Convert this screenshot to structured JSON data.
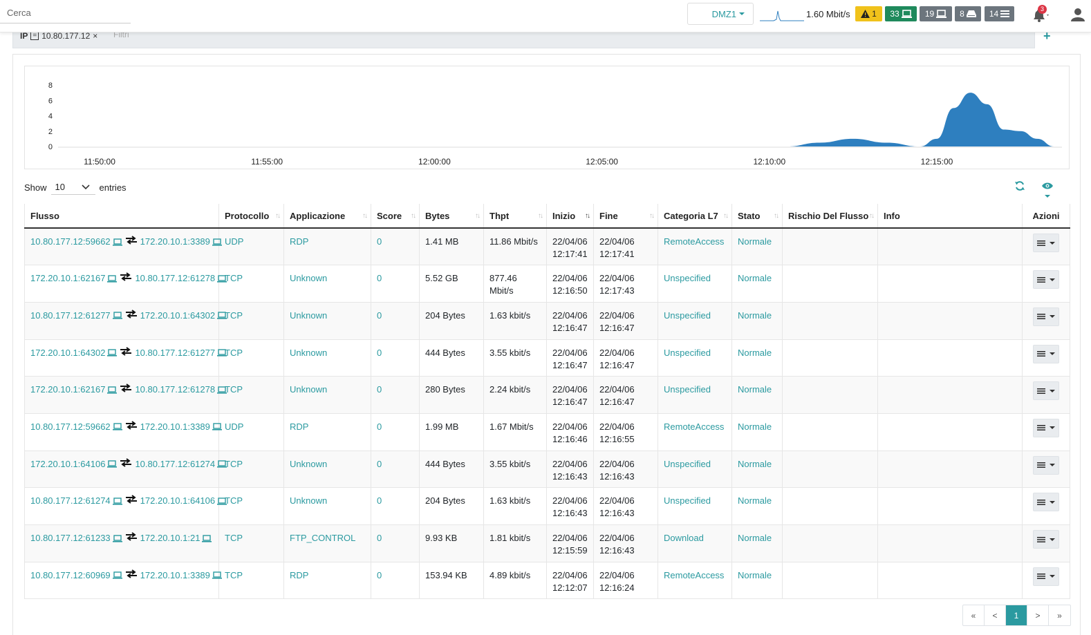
{
  "topbar": {
    "search_placeholder": "Cerca",
    "interface": "DMZ1",
    "throughput": "1.60 Mbit/s",
    "alerts_count": "1",
    "devices_count": "33",
    "hosts_count": "19",
    "flows_count": "8",
    "menu_count": "14",
    "notifications_count": "3",
    "colors": {
      "warning": "#f0c21b",
      "success": "#1f8a5c",
      "secondary": "#6c757d",
      "accent": "#2b9aa0"
    }
  },
  "filter": {
    "field": "IP",
    "operator": "=",
    "value": "10.80.177.12",
    "remove": "×",
    "placeholder": "Filtri",
    "add": "+"
  },
  "chart_data": {
    "type": "area",
    "yticks": [
      "0",
      "2",
      "4",
      "6",
      "8"
    ],
    "ylim": [
      0,
      8
    ],
    "xticks": [
      "11:50:00",
      "11:55:00",
      "12:00:00",
      "12:05:00",
      "12:10:00",
      "12:15:00"
    ],
    "x": [
      "12:10:30",
      "12:11:30",
      "12:12:30",
      "12:13:30",
      "12:14:30",
      "12:15:00",
      "12:15:30",
      "12:16:00",
      "12:16:30",
      "12:17:00",
      "12:17:30",
      "12:18:00",
      "12:18:30"
    ],
    "values": [
      0,
      0.5,
      1,
      0.5,
      0,
      1,
      5,
      7,
      5.5,
      2.2,
      2,
      1,
      0
    ],
    "color": "#2e7fbf"
  },
  "table": {
    "show_label": "Show",
    "page_length": "10",
    "entries_label": "entries",
    "columns": [
      "Flusso",
      "Protocollo",
      "Applicazione",
      "Score",
      "Bytes",
      "Thpt",
      "Inizio",
      "Fine",
      "Categoria L7",
      "Stato",
      "Rischio Del Flusso",
      "Info",
      "Azioni"
    ],
    "rows": [
      {
        "src": "10.80.177.12:59662",
        "dst": "172.20.10.1:3389",
        "proto": "UDP",
        "app": "RDP",
        "score": "0",
        "bytes": "1.41 MB",
        "thpt": "11.86 Mbit/s",
        "start": "22/04/06 12:17:41",
        "end": "22/04/06 12:17:41",
        "cat": "RemoteAccess",
        "state": "Normale",
        "risk": "",
        "info": ""
      },
      {
        "src": "172.20.10.1:62167",
        "dst": "10.80.177.12:61278",
        "proto": "TCP",
        "app": "Unknown",
        "score": "0",
        "bytes": "5.52 GB",
        "thpt": "877.46 Mbit/s",
        "start": "22/04/06 12:16:50",
        "end": "22/04/06 12:17:43",
        "cat": "Unspecified",
        "state": "Normale",
        "risk": "",
        "info": ""
      },
      {
        "src": "10.80.177.12:61277",
        "dst": "172.20.10.1:64302",
        "proto": "TCP",
        "app": "Unknown",
        "score": "0",
        "bytes": "204 Bytes",
        "thpt": "1.63 kbit/s",
        "start": "22/04/06 12:16:47",
        "end": "22/04/06 12:16:47",
        "cat": "Unspecified",
        "state": "Normale",
        "risk": "",
        "info": ""
      },
      {
        "src": "172.20.10.1:64302",
        "dst": "10.80.177.12:61277",
        "proto": "TCP",
        "app": "Unknown",
        "score": "0",
        "bytes": "444 Bytes",
        "thpt": "3.55 kbit/s",
        "start": "22/04/06 12:16:47",
        "end": "22/04/06 12:16:47",
        "cat": "Unspecified",
        "state": "Normale",
        "risk": "",
        "info": ""
      },
      {
        "src": "172.20.10.1:62167",
        "dst": "10.80.177.12:61278",
        "proto": "TCP",
        "app": "Unknown",
        "score": "0",
        "bytes": "280 Bytes",
        "thpt": "2.24 kbit/s",
        "start": "22/04/06 12:16:47",
        "end": "22/04/06 12:16:47",
        "cat": "Unspecified",
        "state": "Normale",
        "risk": "",
        "info": ""
      },
      {
        "src": "10.80.177.12:59662",
        "dst": "172.20.10.1:3389",
        "proto": "UDP",
        "app": "RDP",
        "score": "0",
        "bytes": "1.99 MB",
        "thpt": "1.67 Mbit/s",
        "start": "22/04/06 12:16:46",
        "end": "22/04/06 12:16:55",
        "cat": "RemoteAccess",
        "state": "Normale",
        "risk": "",
        "info": ""
      },
      {
        "src": "172.20.10.1:64106",
        "dst": "10.80.177.12:61274",
        "proto": "TCP",
        "app": "Unknown",
        "score": "0",
        "bytes": "444 Bytes",
        "thpt": "3.55 kbit/s",
        "start": "22/04/06 12:16:43",
        "end": "22/04/06 12:16:43",
        "cat": "Unspecified",
        "state": "Normale",
        "risk": "",
        "info": ""
      },
      {
        "src": "10.80.177.12:61274",
        "dst": "172.20.10.1:64106",
        "proto": "TCP",
        "app": "Unknown",
        "score": "0",
        "bytes": "204 Bytes",
        "thpt": "1.63 kbit/s",
        "start": "22/04/06 12:16:43",
        "end": "22/04/06 12:16:43",
        "cat": "Unspecified",
        "state": "Normale",
        "risk": "",
        "info": ""
      },
      {
        "src": "10.80.177.12:61233",
        "dst": "172.20.10.1:21",
        "proto": "TCP",
        "app": "FTP_CONTROL",
        "score": "0",
        "bytes": "9.93 KB",
        "thpt": "1.81 kbit/s",
        "start": "22/04/06 12:15:59",
        "end": "22/04/06 12:16:43",
        "cat": "Download",
        "state": "Normale",
        "risk": "",
        "info": ""
      },
      {
        "src": "10.80.177.12:60969",
        "dst": "172.20.10.1:3389",
        "proto": "TCP",
        "app": "RDP",
        "score": "0",
        "bytes": "153.94 KB",
        "thpt": "4.89 kbit/s",
        "start": "22/04/06 12:12:07",
        "end": "22/04/06 12:16:24",
        "cat": "RemoteAccess",
        "state": "Normale",
        "risk": "",
        "info": ""
      }
    ]
  },
  "pagination": {
    "first": "«",
    "prev": "<",
    "current": "1",
    "next": ">",
    "last": "»"
  }
}
